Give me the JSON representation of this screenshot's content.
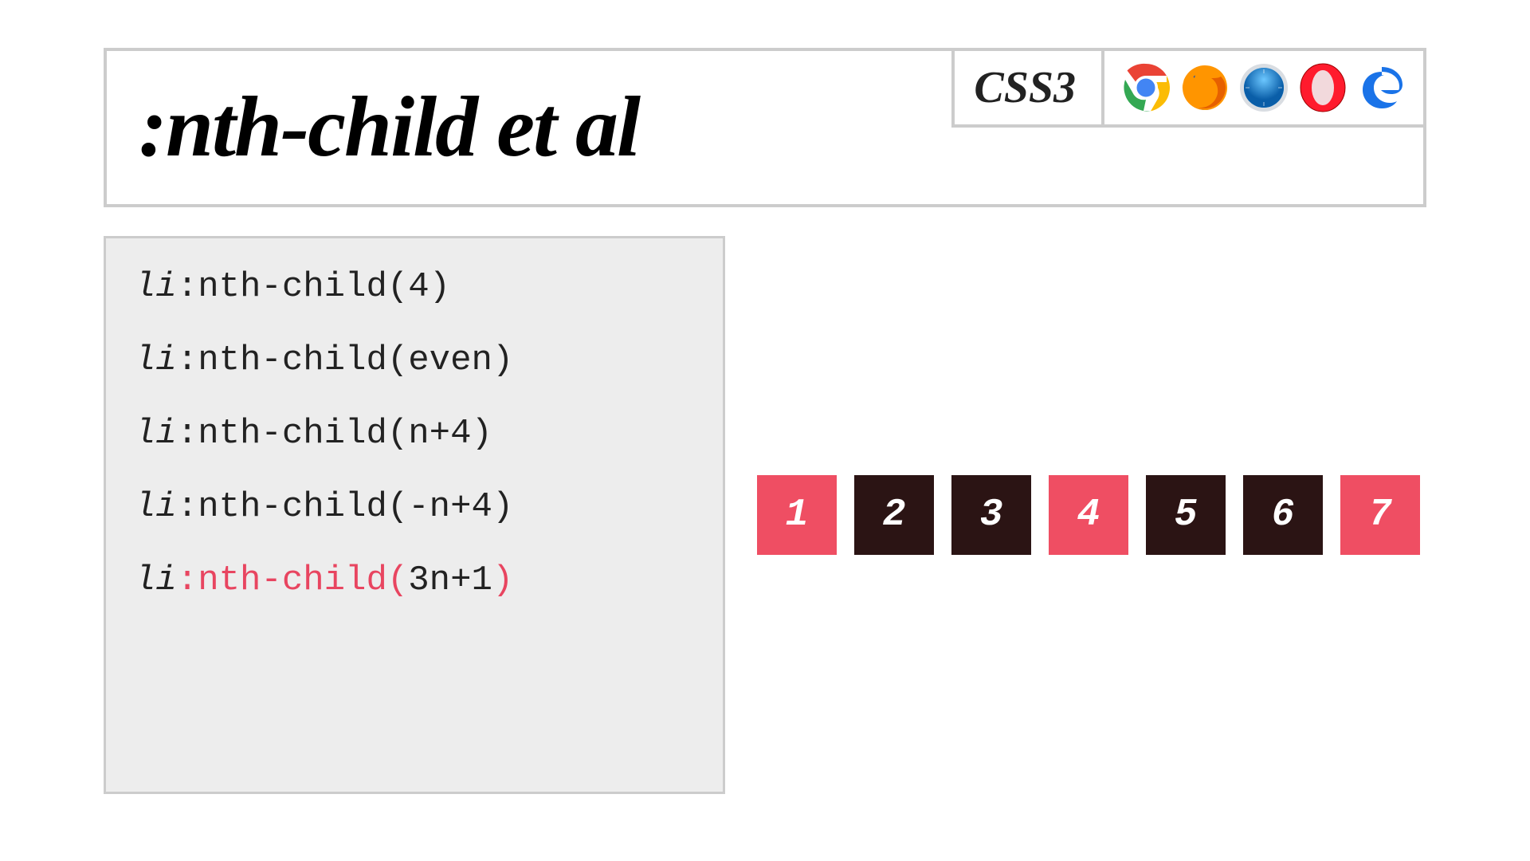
{
  "header": {
    "title": ":nth-child et al",
    "css_label": "CSS3",
    "browsers": [
      "chrome",
      "firefox",
      "safari",
      "opera",
      "edge"
    ]
  },
  "code": {
    "lines": [
      {
        "tag": "li",
        "selector": ":nth-child(",
        "arg": "4",
        "close": ")",
        "active": false
      },
      {
        "tag": "li",
        "selector": ":nth-child(",
        "arg": "even",
        "close": ")",
        "active": false
      },
      {
        "tag": "li",
        "selector": ":nth-child(",
        "arg": "n+4",
        "close": ")",
        "active": false
      },
      {
        "tag": "li",
        "selector": ":nth-child(",
        "arg": "-n+4",
        "close": ")",
        "active": false
      },
      {
        "tag": "li",
        "selector": ":nth-child(",
        "arg": "3n+1",
        "close": ")",
        "active": true
      }
    ]
  },
  "demo": {
    "items": [
      {
        "label": "1",
        "selected": true
      },
      {
        "label": "2",
        "selected": false
      },
      {
        "label": "3",
        "selected": false
      },
      {
        "label": "4",
        "selected": true
      },
      {
        "label": "5",
        "selected": false
      },
      {
        "label": "6",
        "selected": false
      },
      {
        "label": "7",
        "selected": true
      }
    ]
  },
  "colors": {
    "highlight": "#ef4e63",
    "box_dark": "#2b1414",
    "code_bg": "#ededed",
    "border": "#cccccc"
  }
}
